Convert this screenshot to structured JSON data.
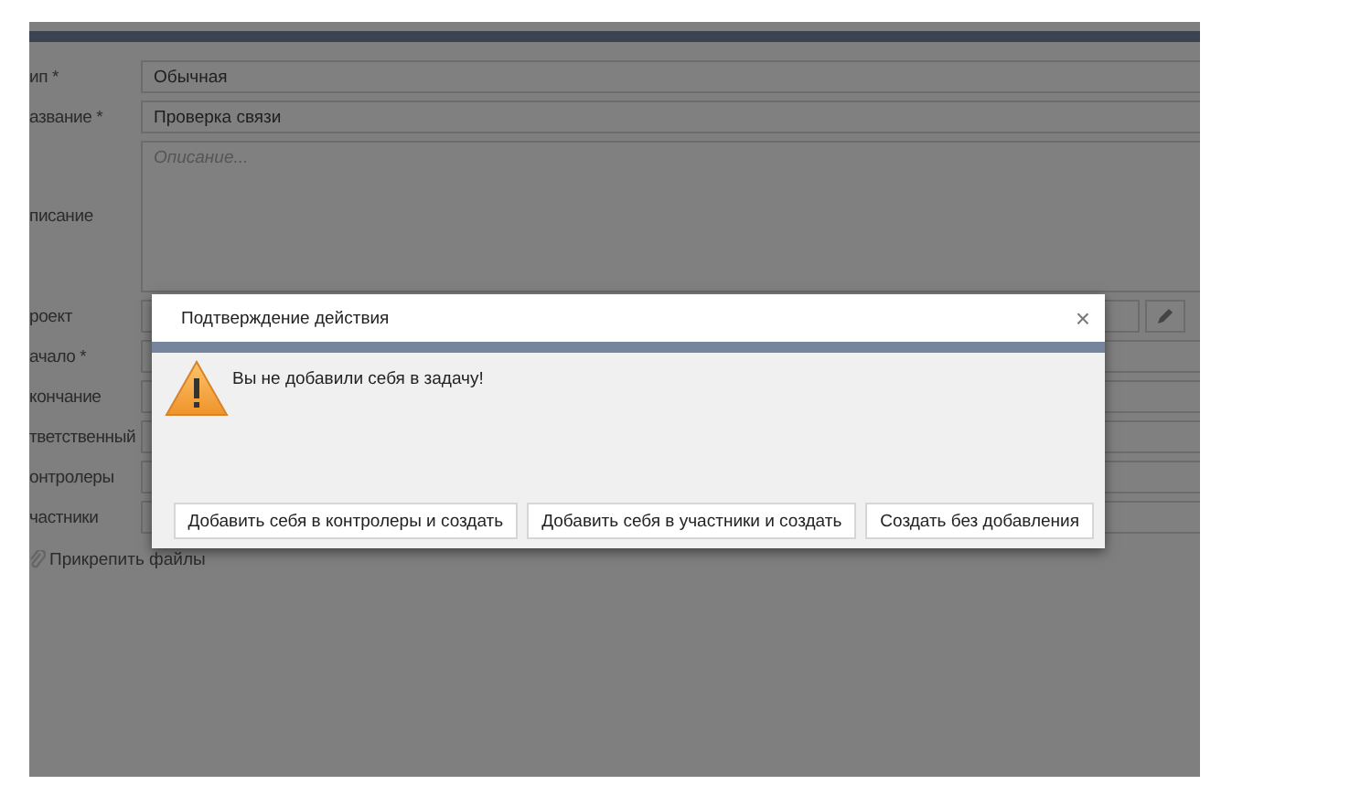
{
  "form": {
    "fields": [
      {
        "kind": "text",
        "label": "ип *",
        "value": "Обычная"
      },
      {
        "kind": "text",
        "label": "азвание *",
        "value": "Проверка связи"
      },
      {
        "kind": "textarea",
        "label": "писание",
        "placeholder": "Описание..."
      },
      {
        "kind": "lookup",
        "label": "роект"
      },
      {
        "kind": "text",
        "label": "ачало *"
      },
      {
        "kind": "text",
        "label": "кончание"
      },
      {
        "kind": "text",
        "label": "тветственный"
      },
      {
        "kind": "text",
        "label": "онтролеры"
      },
      {
        "kind": "text",
        "label": "частники"
      }
    ],
    "attach_link": "Прикрепить файлы"
  },
  "dialog": {
    "title": "Подтверждение действия",
    "close": "×",
    "message": "Вы не добавили себя в задачу!",
    "buttons": [
      "Добавить себя в контролеры и создать",
      "Добавить себя в участники и создать",
      "Создать без добавления"
    ]
  }
}
